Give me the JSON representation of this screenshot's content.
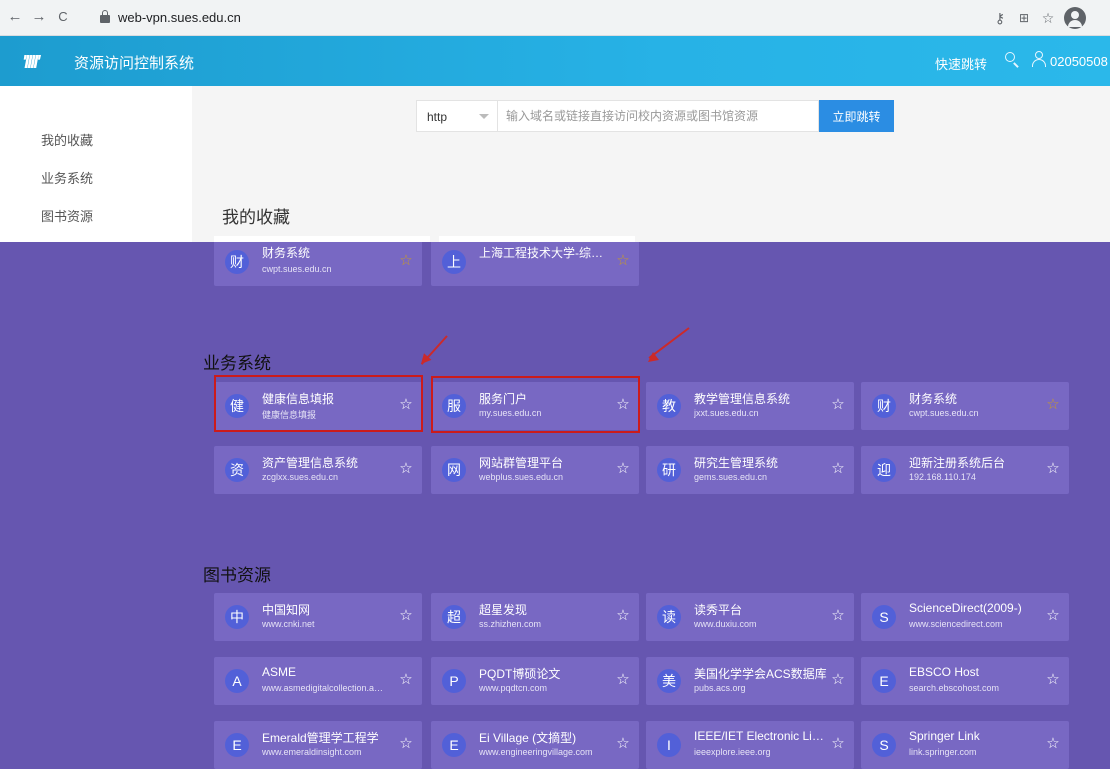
{
  "browser": {
    "back": "←",
    "forward": "→",
    "reload": "C",
    "url": "web-vpn.sues.edu.cn",
    "icons": [
      "key-icon",
      "translate-icon",
      "star-icon",
      "profile-icon"
    ]
  },
  "header": {
    "logo_text": "'IIII'",
    "title": "资源访问控制系统",
    "quick_jump": "快速跳转",
    "user_id": "02050508"
  },
  "sidebar": {
    "items": [
      {
        "label": "我的收藏"
      },
      {
        "label": "业务系统"
      },
      {
        "label": "图书资源"
      }
    ]
  },
  "jump": {
    "scheme": "http",
    "placeholder": "输入域名或链接直接访问校内资源或图书馆资源",
    "button": "立即跳转"
  },
  "sections": {
    "favorites": {
      "title": "我的收藏",
      "cards": [
        {
          "badge": "财",
          "name": "财务系统",
          "host": "cwpt.sues.edu.cn",
          "starred": true
        },
        {
          "badge": "上",
          "name": "上海工程技术大学-综合…",
          "host": "",
          "starred": true
        }
      ]
    },
    "business": {
      "title": "业务系统",
      "cards": [
        {
          "badge": "健",
          "name": "健康信息填报",
          "host": "健康信息填报",
          "starred": false
        },
        {
          "badge": "服",
          "name": "服务门户",
          "host": "my.sues.edu.cn",
          "starred": false
        },
        {
          "badge": "教",
          "name": "教学管理信息系统",
          "host": "jxxt.sues.edu.cn",
          "starred": false
        },
        {
          "badge": "财",
          "name": "财务系统",
          "host": "cwpt.sues.edu.cn",
          "starred": true
        },
        {
          "badge": "资",
          "name": "资产管理信息系统",
          "host": "zcglxx.sues.edu.cn",
          "starred": false
        },
        {
          "badge": "网",
          "name": "网站群管理平台",
          "host": "webplus.sues.edu.cn",
          "starred": false
        },
        {
          "badge": "研",
          "name": "研究生管理系统",
          "host": "gems.sues.edu.cn",
          "starred": false
        },
        {
          "badge": "迎",
          "name": "迎新注册系统后台",
          "host": "192.168.110.174",
          "starred": false
        }
      ]
    },
    "library": {
      "title": "图书资源",
      "cards": [
        {
          "badge": "中",
          "name": "中国知网",
          "host": "www.cnki.net",
          "starred": false
        },
        {
          "badge": "超",
          "name": "超星发现",
          "host": "ss.zhizhen.com",
          "starred": false
        },
        {
          "badge": "读",
          "name": "读秀平台",
          "host": "www.duxiu.com",
          "starred": false
        },
        {
          "badge": "S",
          "name": "ScienceDirect(2009-)",
          "host": "www.sciencedirect.com",
          "starred": false
        },
        {
          "badge": "A",
          "name": "ASME",
          "host": "www.asmedigitalcollection.a…",
          "starred": false
        },
        {
          "badge": "P",
          "name": "PQDT博硕论文",
          "host": "www.pqdtcn.com",
          "starred": false
        },
        {
          "badge": "美",
          "name": "美国化学学会ACS数据库",
          "host": "pubs.acs.org",
          "starred": false
        },
        {
          "badge": "E",
          "name": "EBSCO Host",
          "host": "search.ebscohost.com",
          "starred": false
        },
        {
          "badge": "E",
          "name": "Emerald管理学工程学",
          "host": "www.emeraldinsight.com",
          "starred": false
        },
        {
          "badge": "E",
          "name": "Ei Village (文摘型)",
          "host": "www.engineeringvillage.com",
          "starred": false
        },
        {
          "badge": "I",
          "name": "IEEE/IET Electronic Lib…",
          "host": "ieeexplore.ieee.org",
          "starred": false
        },
        {
          "badge": "S",
          "name": "Springer Link",
          "host": "link.springer.com",
          "starred": false
        }
      ]
    }
  },
  "colors": {
    "header_start": "#1d9ccf",
    "header_end": "#2bb8ea",
    "content_bg": "#6656b0",
    "card_bg": "#7868c3",
    "badge_bg": "#5260d8",
    "starred": "#c89a2a",
    "annotation": "#cc1b1b",
    "button_bg": "#2b8de3"
  }
}
